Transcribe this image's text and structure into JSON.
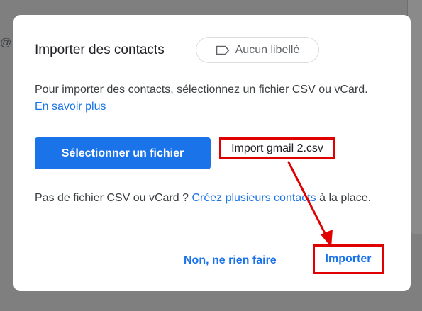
{
  "background": {
    "fragment_text": "@"
  },
  "dialog": {
    "title": "Importer des contacts",
    "label_chip": {
      "icon": "label-tag-icon",
      "text": "Aucun libellé"
    },
    "description": {
      "text": "Pour importer des contacts, sélectionnez un fichier CSV ou vCard.",
      "link": "En savoir plus"
    },
    "select_file_button": "Sélectionner un fichier",
    "selected_file": "Import gmail 2.csv",
    "alternative": {
      "prefix": "Pas de fichier CSV ou vCard ?",
      "link": "Créez plusieurs contacts",
      "suffix": "à la place."
    },
    "actions": {
      "cancel": "Non, ne rien faire",
      "import": "Importer"
    }
  },
  "annotations": {
    "highlight_color": "#e00000"
  },
  "colors": {
    "accent": "#1a73e8",
    "overlay": "#7f7f7f"
  }
}
